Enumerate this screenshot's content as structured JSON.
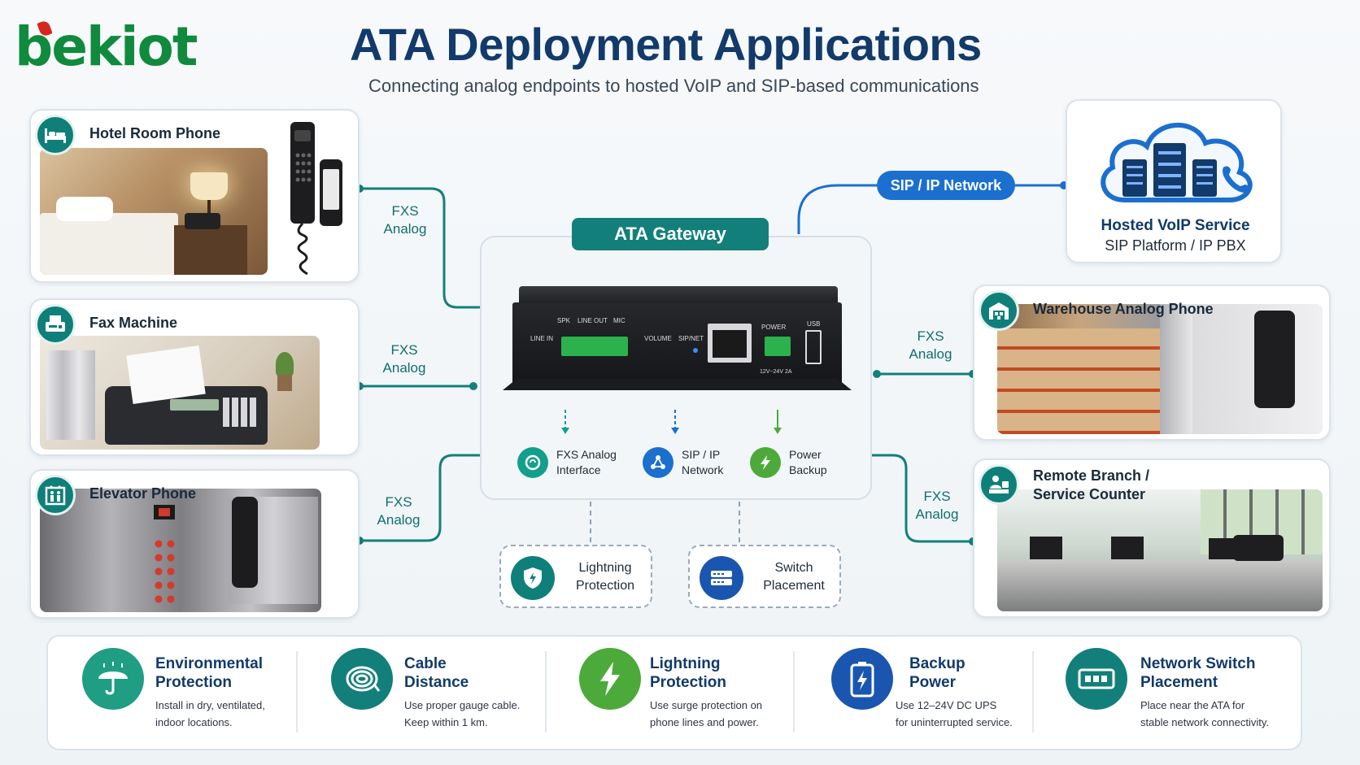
{
  "brand": {
    "logo_text": "bekiot"
  },
  "header": {
    "title": "ATA Deployment Applications",
    "subtitle": "Connecting analog endpoints to hosted VoIP and SIP-based communications"
  },
  "left_cards": [
    {
      "title": "Hotel Room Phone",
      "icon": "bed-icon"
    },
    {
      "title": "Fax Machine",
      "icon": "fax-icon"
    },
    {
      "title": "Elevator Phone",
      "icon": "elevator-icon"
    }
  ],
  "right_cards": [
    {
      "title": "Warehouse Analog Phone",
      "icon": "warehouse-icon"
    },
    {
      "title_line1": "Remote Branch /",
      "title_line2": "Service Counter",
      "icon": "counter-icon"
    }
  ],
  "links": {
    "fxs_line1": "FXS",
    "fxs_line2": "Analog",
    "sip_network": "SIP / IP Network"
  },
  "gateway": {
    "badge": "ATA Gateway",
    "panel": {
      "line_in": "LINE IN",
      "spk": "SPK",
      "line_out": "LINE OUT",
      "mic": "MIC",
      "volume": "VOLUME",
      "sip_net": "SIP/NET",
      "power": "POWER",
      "usb": "USB",
      "power_rating": "12V~24V 2A"
    },
    "features": [
      {
        "line1": "FXS Analog",
        "line2": "Interface",
        "icon": "fxs-interface-icon",
        "color": "#13a08a"
      },
      {
        "line1": "SIP / IP",
        "line2": "Network",
        "icon": "network-icon",
        "color": "#1a6fcf"
      },
      {
        "line1": "Power",
        "line2": "Backup",
        "icon": "lightning-icon",
        "color": "#4caa3a"
      }
    ],
    "options": [
      {
        "line1": "Lightning",
        "line2": "Protection",
        "icon": "shield-icon",
        "color": "#0f7f7a"
      },
      {
        "line1": "Switch",
        "line2": "Placement",
        "icon": "switch-icon",
        "color": "#1a56b0"
      }
    ]
  },
  "voip": {
    "title": "Hosted VoIP Service",
    "subtitle": "SIP Platform / IP PBX",
    "icon": "cloud-server-icon"
  },
  "tips": [
    {
      "title_line1": "Environmental",
      "title_line2": "Protection",
      "desc_line1": "Install in dry, ventilated,",
      "desc_line2": "indoor locations.",
      "icon": "umbrella-icon",
      "color": "#1f9e84"
    },
    {
      "title_line1": "Cable",
      "title_line2": "Distance",
      "desc_line1": "Use proper gauge cable.",
      "desc_line2": "Keep within 1 km.",
      "icon": "cable-icon",
      "color": "#137f7a"
    },
    {
      "title_line1": "Lightning",
      "title_line2": "Protection",
      "desc_line1": "Use surge protection on",
      "desc_line2": "phone lines and power.",
      "icon": "lightning-icon",
      "color": "#4caa3a"
    },
    {
      "title_line1": "Backup",
      "title_line2": "Power",
      "desc_line1": "Use 12–24V DC UPS",
      "desc_line2": "for uninterrupted service.",
      "icon": "battery-icon",
      "color": "#1a56b0"
    },
    {
      "title_line1": "Network Switch",
      "title_line2": "Placement",
      "desc_line1": "Place near the ATA for",
      "desc_line2": "stable network connectivity.",
      "icon": "switch-icon",
      "color": "#137f7a"
    }
  ]
}
